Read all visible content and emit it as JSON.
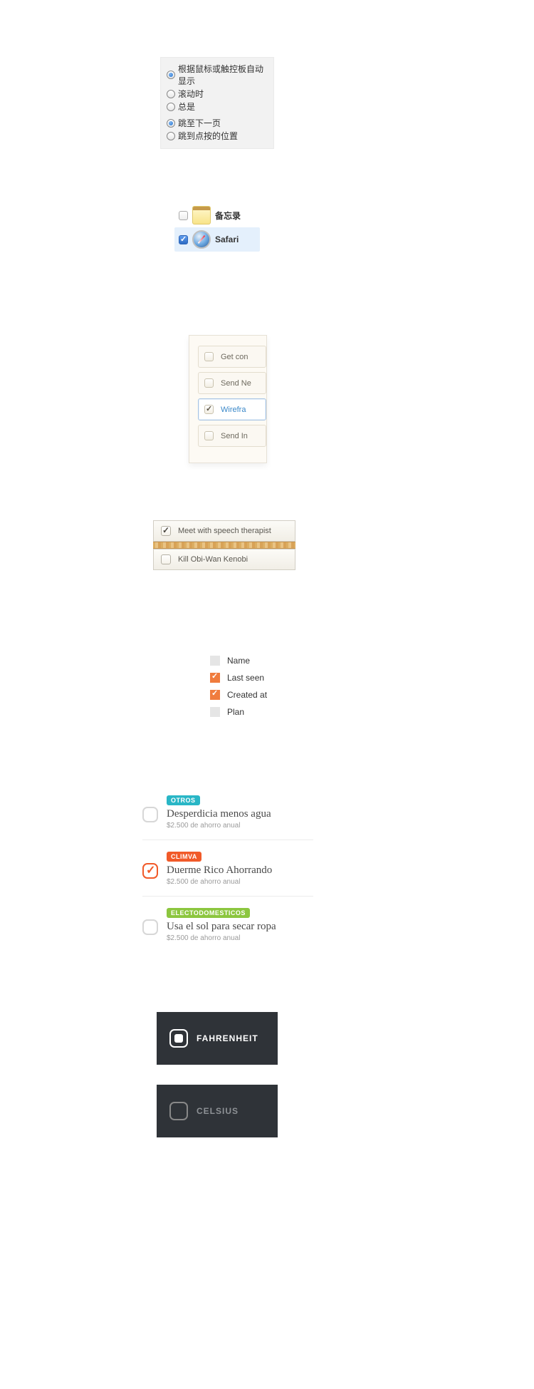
{
  "prefs": {
    "group1": [
      {
        "label": "根据鼠标或触控板自动显示",
        "checked": true
      },
      {
        "label": "滚动时",
        "checked": false
      },
      {
        "label": "总是",
        "checked": false
      }
    ],
    "group2": [
      {
        "label": "跳至下一页",
        "checked": true
      },
      {
        "label": "跳到点按的位置",
        "checked": false
      }
    ]
  },
  "apps": [
    {
      "label": "备忘录",
      "checked": false,
      "selected": false,
      "icon": "notes"
    },
    {
      "label": "Safari",
      "checked": true,
      "selected": true,
      "icon": "safari"
    }
  ],
  "todos": [
    {
      "label": "Get con",
      "checked": false,
      "selected": false
    },
    {
      "label": "Send Ne",
      "checked": false,
      "selected": false
    },
    {
      "label": "Wirefra",
      "checked": true,
      "selected": true
    },
    {
      "label": "Send In",
      "checked": false,
      "selected": false
    }
  ],
  "tasks": [
    {
      "label": "Meet with speech therapist",
      "checked": true
    },
    {
      "label": "Kill Obi-Wan Kenobi",
      "checked": false
    }
  ],
  "fields": [
    {
      "label": "Name",
      "checked": false
    },
    {
      "label": "Last seen",
      "checked": true
    },
    {
      "label": "Created at",
      "checked": true
    },
    {
      "label": "Plan",
      "checked": false
    }
  ],
  "tips": [
    {
      "tag": "OTROS",
      "tag_color": "#29b6c6",
      "title": "Desperdicia menos agua",
      "sub": "$2.500 de ahorro anual",
      "checked": false
    },
    {
      "tag": "CLIMVA",
      "tag_color": "#f15a29",
      "title": "Duerme Rico Ahorrando",
      "sub": "$2.500 de ahorro anual",
      "checked": true
    },
    {
      "tag": "ELECTODOMESTICOS",
      "tag_color": "#8cc63f",
      "title": "Usa el sol para secar ropa",
      "sub": "$2.500 de ahorro anual",
      "checked": false
    }
  ],
  "temps": [
    {
      "label": "FAHRENHEIT",
      "checked": true
    },
    {
      "label": "CELSIUS",
      "checked": false
    }
  ]
}
